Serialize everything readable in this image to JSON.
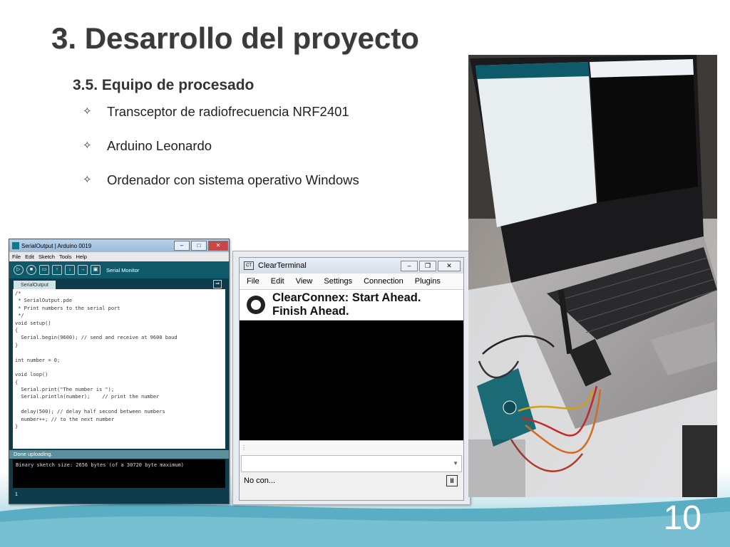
{
  "slide": {
    "title": "3. Desarrollo del proyecto",
    "subtitle": "3.5. Equipo de procesado",
    "bullets": [
      "Transceptor de radiofrecuencia NRF2401",
      "Arduino Leonardo",
      "Ordenador con sistema operativo Windows"
    ],
    "page_number": "10"
  },
  "arduino": {
    "window_title": "SerialOutput | Arduino 0019",
    "menu": [
      "File",
      "Edit",
      "Sketch",
      "Tools",
      "Help"
    ],
    "toolbar_label": "Serial Monitor",
    "tab": "SerialOutput",
    "code": [
      "/*",
      " * SerialOutput.pde",
      " * Print numbers to the serial port",
      " */",
      "void setup()",
      "{",
      "  Serial.begin(9600); // send and receive at 9600 baud",
      "}",
      "",
      "int number = 0;",
      "",
      "void loop()",
      "{",
      "  Serial.print(\"The number is \");",
      "  Serial.println(number);    // print the number",
      "",
      "  delay(500); // delay half second between numbers",
      "  number++; // to the next number",
      "}"
    ],
    "status": "Done uploading.",
    "console": "Binary sketch size: 2656 bytes (of a 30720 byte maximum)",
    "line_number": "1"
  },
  "clearterminal": {
    "window_title": "ClearTerminal",
    "menu": [
      "File",
      "Edit",
      "View",
      "Settings",
      "Connection",
      "Plugins"
    ],
    "banner_line1": "ClearConnex: Start Ahead.",
    "banner_line2": "Finish Ahead.",
    "status": "No con..."
  }
}
